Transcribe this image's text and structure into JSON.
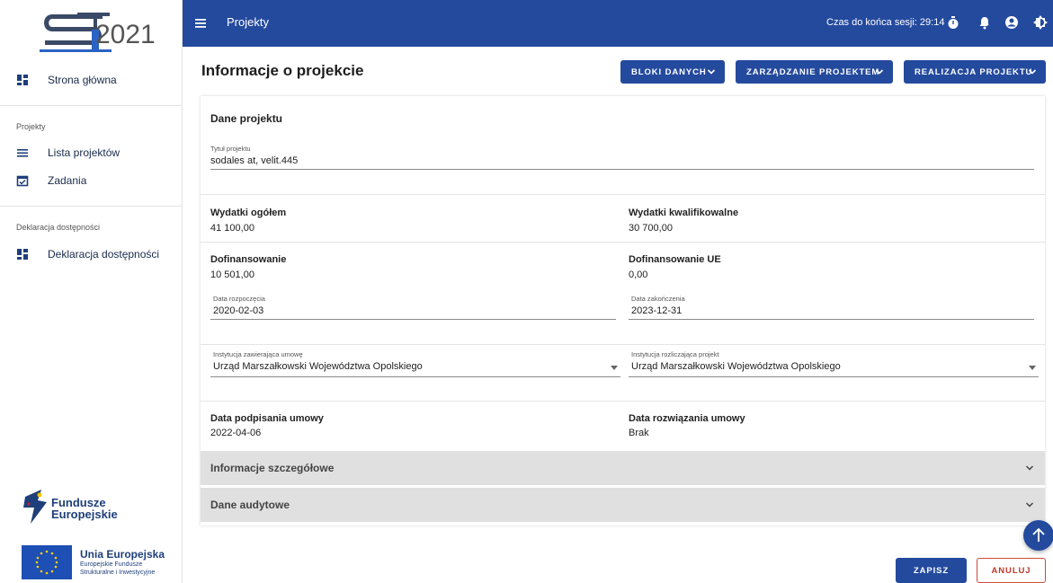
{
  "app": {
    "logo_text": "2021",
    "title": "Projekty",
    "session_label": "Czas do końca sesji: 29:14"
  },
  "sidebar": {
    "home_label": "Strona główna",
    "section_projects": "Projekty",
    "projects_list_label": "Lista projektów",
    "tasks_label": "Zadania",
    "section_accessibility": "Deklaracja dostępności",
    "accessibility_label": "Deklaracja dostępności",
    "fe_logo": {
      "line1": "Fundusze",
      "line2": "Europejskie"
    },
    "eu_logo": {
      "line1": "Unia Europejska",
      "line2": "Europejskie Fundusze",
      "line3": "Strukturalne i Inwestycyjne"
    }
  },
  "header": {
    "page_title": "Informacje o projekcie",
    "buttons": [
      "BLOKI DANYCH",
      "ZARZĄDZANIE PROJEKTEM",
      "REALIZACJA PROJEKTU"
    ]
  },
  "project": {
    "section_title": "Dane projektu",
    "title_label": "Tytuł projektu",
    "title_value": "sodales at, velit.445",
    "total_expenses_label": "Wydatki ogółem",
    "total_expenses_value": "41 100,00",
    "eligible_expenses_label": "Wydatki kwalifikowalne",
    "eligible_expenses_value": "30 700,00",
    "funding_label": "Dofinansowanie",
    "funding_value": "10 501,00",
    "eu_funding_label": "Dofinansowanie UE",
    "eu_funding_value": "0,00",
    "start_date_label": "Data rozpoczęcia",
    "start_date_value": "2020-02-03",
    "end_date_label": "Data zakończenia",
    "end_date_value": "2023-12-31",
    "contracting_inst_label": "Instytucja zawierająca umowę",
    "contracting_inst_value": "Urząd Marszałkowski Województwa Opolskiego",
    "settling_inst_label": "Instytucja rozliczająca projekt",
    "settling_inst_value": "Urząd Marszałkowski Województwa Opolskiego",
    "signing_date_label": "Data podpisania umowy",
    "signing_date_value": "2022-04-06",
    "termination_date_label": "Data rozwiązania umowy",
    "termination_date_value": "Brak"
  },
  "accordions": [
    "Informacje szczegółowe",
    "Dane audytowe"
  ],
  "footer": {
    "save_label": "ZAPISZ",
    "cancel_label": "ANULUJ"
  },
  "colors": {
    "primary": "#244a9e",
    "danger": "#c0392b",
    "accordion_bg": "#e0e0e0"
  }
}
